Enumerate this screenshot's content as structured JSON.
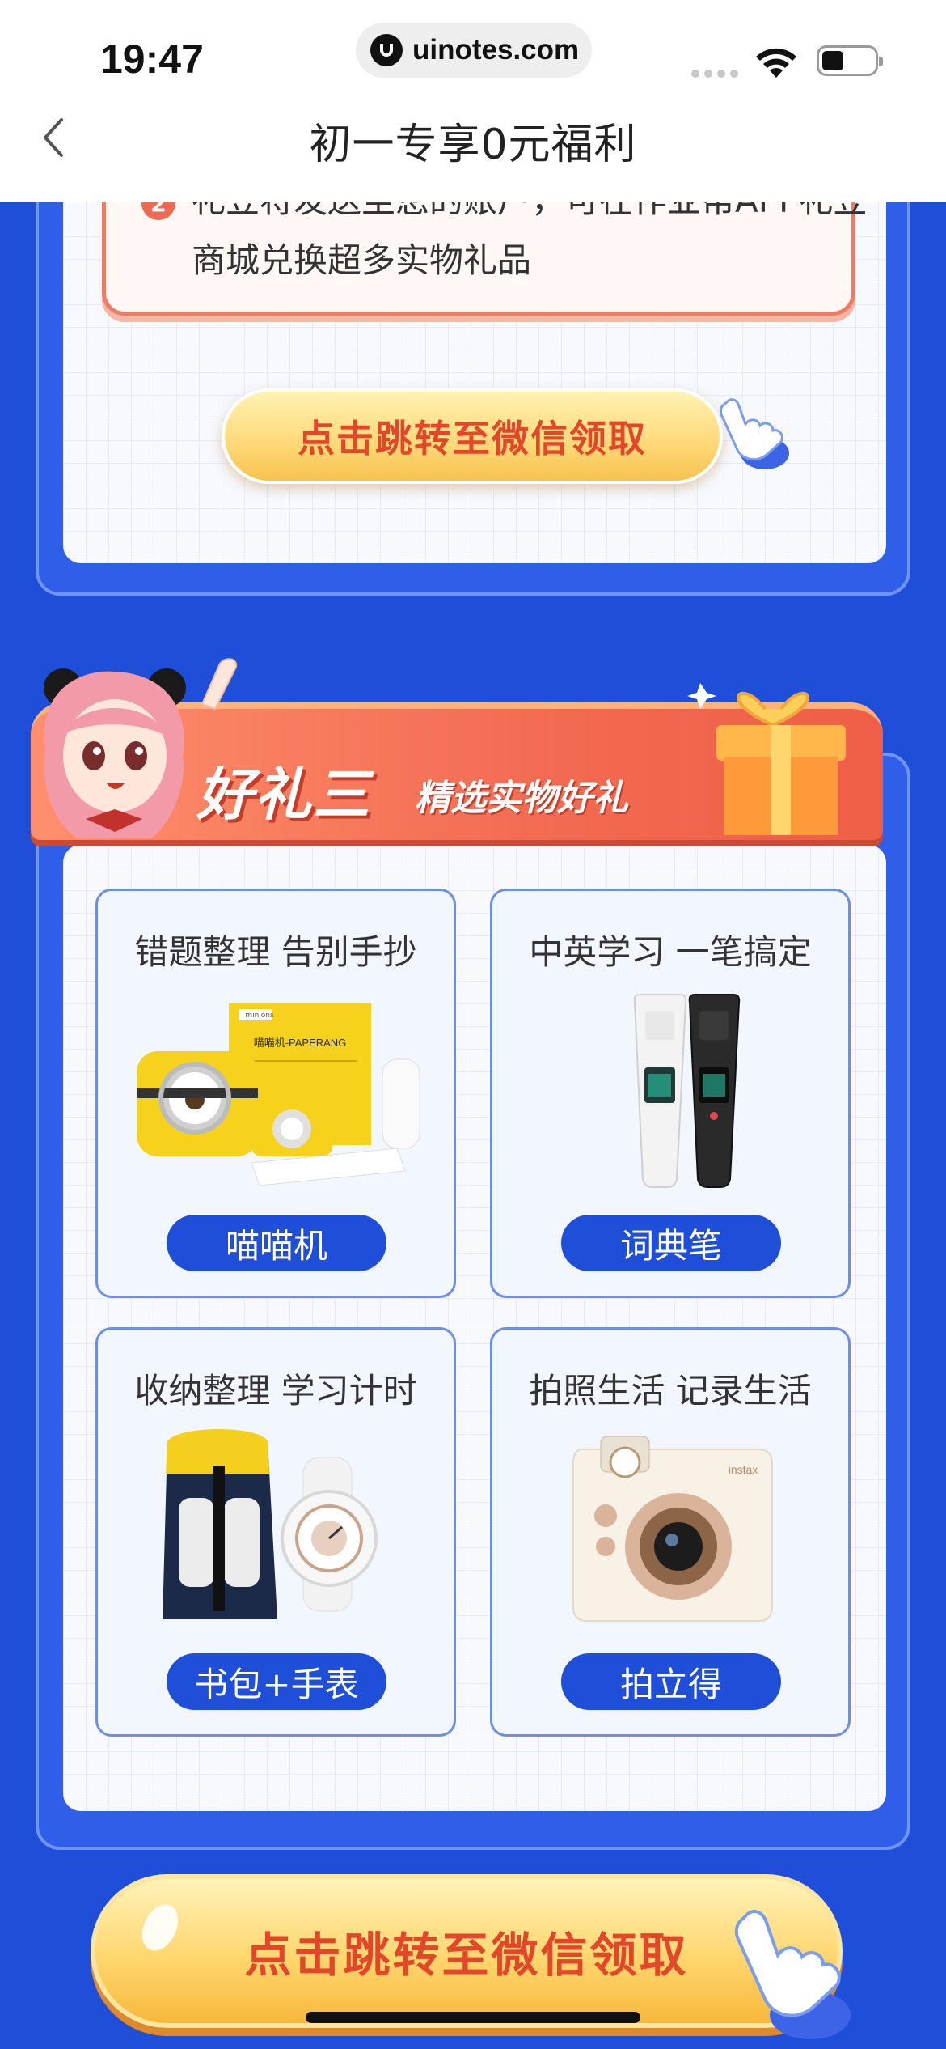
{
  "status_bar": {
    "time": "19:47",
    "url": "uinotes.com"
  },
  "nav": {
    "title": "初一专享0元福利"
  },
  "notice": {
    "number": "2",
    "line1": "礼豆将发送至您的账户，可在作业帮APP礼豆",
    "line2": "商城兑换超多实物礼品"
  },
  "cta_small": {
    "label": "点击跳转至微信领取"
  },
  "section": {
    "title": "好礼三",
    "subtitle": "精选实物好礼"
  },
  "gifts": [
    {
      "caption": "错题整理 告别手抄",
      "button": "喵喵机",
      "icon": "printer-image"
    },
    {
      "caption": "中英学习 一笔搞定",
      "button": "词典笔",
      "icon": "dictionary-pen-image"
    },
    {
      "caption": "收纳整理 学习计时",
      "button": "书包+手表",
      "icon": "backpack-watch-image"
    },
    {
      "caption": "拍照生活 记录生活",
      "button": "拍立得",
      "icon": "instant-camera-image"
    }
  ],
  "cta_big": {
    "label": "点击跳转至微信领取"
  },
  "printer_labels": {
    "box": "喵喵机-PAPERANG",
    "brand": "minions"
  },
  "camera_brand": "instax"
}
